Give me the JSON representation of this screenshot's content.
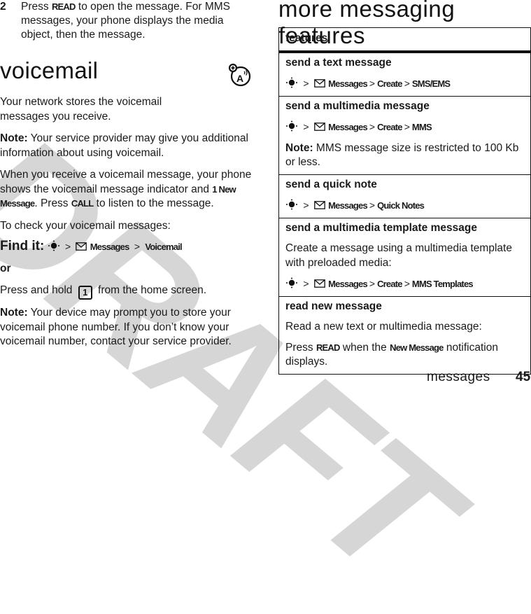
{
  "watermark": "DRAFT",
  "left": {
    "step": {
      "number": "2",
      "text_parts": [
        "Press ",
        "READ",
        " to open the message. For MMS messages, your phone displays the media object, then the message."
      ]
    },
    "voicemail": {
      "title": "voicemail",
      "icon": "voicemail-network-feature-icon",
      "intro": "Your network stores the voicemail messages you receive.",
      "note1_label": "Note:",
      "note1_text": " Your service provider may give you additional information about using voicemail.",
      "when_parts": [
        "When you receive a voicemail message, your phone shows the voicemail message indicator and ",
        "1 New Message",
        ". Press ",
        "CALL",
        " to listen to the message."
      ],
      "check": "To check your voicemail messages:",
      "findit_label": "Find it:",
      "findit_path": [
        "Messages",
        "Voicemail"
      ],
      "or": "or",
      "press_hold_before": "Press and hold ",
      "press_hold_key": "1",
      "press_hold_after": " from the home screen.",
      "note2_label": "Note:",
      "note2_text": " Your device may prompt you to store your voicemail phone number. If you don’t know your voicemail number, contact your service provider."
    }
  },
  "right": {
    "title": "more messaging features",
    "table_header": "features",
    "rows": [
      {
        "title": "send a text message",
        "path": [
          "Messages",
          "Create",
          "SMS/EMS"
        ]
      },
      {
        "title": "send a multimedia message",
        "path": [
          "Messages",
          "Create",
          "MMS"
        ],
        "note_label": "Note:",
        "note_text": " MMS message size is restricted to 100 Kb or less."
      },
      {
        "title": "send a quick note",
        "path": [
          "Messages",
          "Quick Notes"
        ]
      },
      {
        "title": "send a multimedia template message",
        "desc": "Create a message using a multimedia template with preloaded media:",
        "path": [
          "Messages",
          "Create",
          "MMS Templates"
        ]
      },
      {
        "title": "read new message",
        "desc": "Read a new text or multimedia message:",
        "press_parts": [
          "Press ",
          "READ",
          " when the ",
          "New Message",
          " notification displays."
        ]
      }
    ]
  },
  "footer": {
    "section": "messages",
    "page": "45"
  },
  "icons": {
    "nav": "nav-key-center-icon",
    "messages": "envelope-icon",
    "separator": ">"
  }
}
